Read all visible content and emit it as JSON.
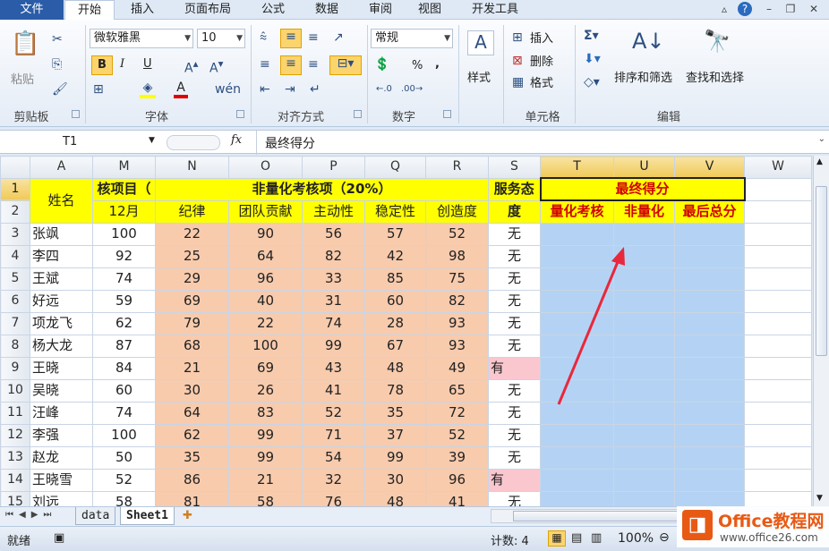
{
  "tabs": {
    "file": "文件",
    "items": [
      "开始",
      "插入",
      "页面布局",
      "公式",
      "数据",
      "审阅",
      "视图",
      "开发工具"
    ]
  },
  "ribbon": {
    "paste": "粘贴",
    "clipboard": "剪贴板",
    "font_name": "微软雅黑",
    "font_size": "10",
    "font_group": "字体",
    "align_group": "对齐方式",
    "number_format": "常规",
    "number_group": "数字",
    "styles": "样式",
    "insert": "插入",
    "delete": "删除",
    "format": "格式",
    "cells_group": "单元格",
    "sort_filter": "排序和筛选",
    "find_select": "查找和选择",
    "edit_group": "编辑",
    "bold": "B",
    "italic": "I",
    "underline": "U",
    "percent": "%",
    "comma": ","
  },
  "formula_bar": {
    "cell_ref": "T1",
    "fx": "fx",
    "content": "最终得分"
  },
  "columns": [
    "A",
    "M",
    "N",
    "O",
    "P",
    "Q",
    "R",
    "S",
    "T",
    "U",
    "V",
    "W"
  ],
  "header_row1": {
    "name": "姓名",
    "m": "核项目（",
    "n_r": "非量化考核项（20%）",
    "s": "服务态",
    "t_v": "最终得分"
  },
  "header_row2": {
    "m": "12月",
    "n": "纪律",
    "o": "团队贡献",
    "p": "主动性",
    "q": "稳定性",
    "r": "创造度",
    "s": "度",
    "t": "量化考核",
    "u": "非量化",
    "v": "最后总分"
  },
  "rows": [
    {
      "num": "3",
      "name": "张飒",
      "m": "100",
      "n": "22",
      "o": "90",
      "p": "56",
      "q": "57",
      "r": "52",
      "s": "无"
    },
    {
      "num": "4",
      "name": "李四",
      "m": "92",
      "n": "25",
      "o": "64",
      "p": "82",
      "q": "42",
      "r": "98",
      "s": "无"
    },
    {
      "num": "5",
      "name": "王斌",
      "m": "74",
      "n": "29",
      "o": "96",
      "p": "33",
      "q": "85",
      "r": "75",
      "s": "无"
    },
    {
      "num": "6",
      "name": "好远",
      "m": "59",
      "n": "69",
      "o": "40",
      "p": "31",
      "q": "60",
      "r": "82",
      "s": "无"
    },
    {
      "num": "7",
      "name": "项龙飞",
      "m": "62",
      "n": "79",
      "o": "22",
      "p": "74",
      "q": "28",
      "r": "93",
      "s": "无"
    },
    {
      "num": "8",
      "name": "杨大龙",
      "m": "87",
      "n": "68",
      "o": "100",
      "p": "99",
      "q": "67",
      "r": "93",
      "s": "无"
    },
    {
      "num": "9",
      "name": "王晓",
      "m": "84",
      "n": "21",
      "o": "69",
      "p": "43",
      "q": "48",
      "r": "49",
      "s": "有"
    },
    {
      "num": "10",
      "name": "吴晓",
      "m": "60",
      "n": "30",
      "o": "26",
      "p": "41",
      "q": "78",
      "r": "65",
      "s": "无"
    },
    {
      "num": "11",
      "name": "汪峰",
      "m": "74",
      "n": "64",
      "o": "83",
      "p": "52",
      "q": "35",
      "r": "72",
      "s": "无"
    },
    {
      "num": "12",
      "name": "李强",
      "m": "100",
      "n": "62",
      "o": "99",
      "p": "71",
      "q": "37",
      "r": "52",
      "s": "无"
    },
    {
      "num": "13",
      "name": "赵龙",
      "m": "50",
      "n": "35",
      "o": "99",
      "p": "54",
      "q": "99",
      "r": "39",
      "s": "无"
    },
    {
      "num": "14",
      "name": "王晓雪",
      "m": "52",
      "n": "86",
      "o": "21",
      "p": "32",
      "q": "30",
      "r": "96",
      "s": "有"
    },
    {
      "num": "15",
      "name": "刘远",
      "m": "58",
      "n": "81",
      "o": "58",
      "p": "76",
      "q": "48",
      "r": "41",
      "s": "无"
    }
  ],
  "sheets": [
    "data",
    "Sheet1"
  ],
  "status": {
    "ready": "就绪",
    "count": "计数: 4",
    "zoom": "100%"
  },
  "watermark": {
    "brand": "Office教程网",
    "url": "www.office26.com"
  }
}
